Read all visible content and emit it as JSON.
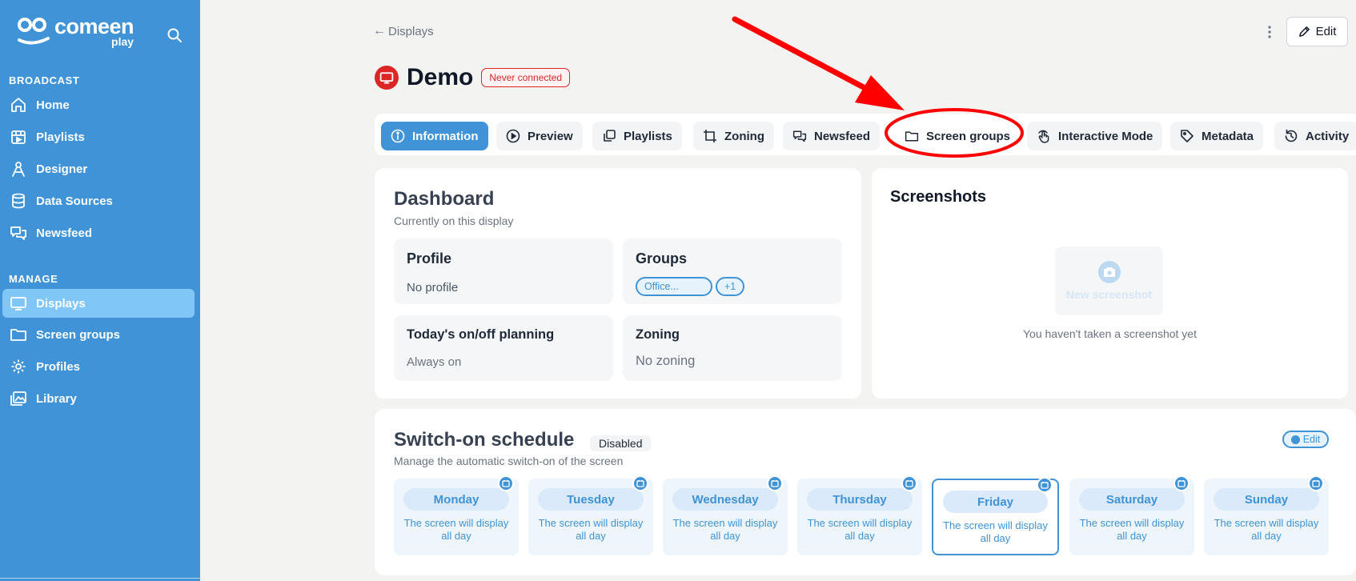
{
  "colors": {
    "sidebar": "#3f93d6",
    "accent": "#3f93d6",
    "active_nav": "#80c6f7",
    "danger": "#dc2626"
  },
  "brand": {
    "name": "comeen",
    "sub": "play"
  },
  "sidebar": {
    "broadcast_label": "BROADCAST",
    "manage_label": "MANAGE",
    "broadcast_items": [
      {
        "label": "Home",
        "icon": "home-icon"
      },
      {
        "label": "Playlists",
        "icon": "playlist-icon"
      },
      {
        "label": "Designer",
        "icon": "designer-icon"
      },
      {
        "label": "Data Sources",
        "icon": "database-icon"
      },
      {
        "label": "Newsfeed",
        "icon": "newsfeed-icon"
      }
    ],
    "manage_items": [
      {
        "label": "Displays",
        "icon": "display-icon",
        "active": true
      },
      {
        "label": "Screen groups",
        "icon": "folder-icon"
      },
      {
        "label": "Profiles",
        "icon": "gear-icon"
      },
      {
        "label": "Library",
        "icon": "library-icon"
      }
    ]
  },
  "header": {
    "back_label": "Displays",
    "title": "Demo",
    "status_badge": "Never connected",
    "edit_label": "Edit"
  },
  "tabs": [
    {
      "label": "Information",
      "icon": "info-icon",
      "active": true
    },
    {
      "label": "Preview",
      "icon": "play-icon"
    },
    {
      "label": "Playlists",
      "icon": "copy-icon"
    },
    {
      "label": "Zoning",
      "icon": "crop-icon"
    },
    {
      "label": "Newsfeed",
      "icon": "newsfeed-icon"
    },
    {
      "label": "Screen groups",
      "icon": "folder-icon"
    },
    {
      "label": "Interactive Mode",
      "icon": "touch-icon"
    },
    {
      "label": "Metadata",
      "icon": "tag-icon"
    },
    {
      "label": "Activity",
      "icon": "history-icon"
    }
  ],
  "dashboard": {
    "title": "Dashboard",
    "subtitle": "Currently on this display",
    "profile": {
      "title": "Profile",
      "value": "No profile"
    },
    "groups": {
      "title": "Groups",
      "tags": [
        "Office...",
        "+1"
      ]
    },
    "planning": {
      "title": "Today's on/off planning",
      "value": "Always on"
    },
    "zoning": {
      "title": "Zoning",
      "value": "No zoning"
    }
  },
  "screenshots": {
    "title": "Screenshots",
    "button_label": "New screenshot",
    "empty_text": "You haven't taken a screenshot yet"
  },
  "schedule": {
    "title": "Switch-on schedule",
    "status": "Disabled",
    "subtitle": "Manage the automatic switch-on of the screen",
    "edit_label": "Edit",
    "days": [
      {
        "name": "Monday",
        "desc": "The screen will display all day"
      },
      {
        "name": "Tuesday",
        "desc": "The screen will display all day"
      },
      {
        "name": "Wednesday",
        "desc": "The screen will display all day"
      },
      {
        "name": "Thursday",
        "desc": "The screen will display all day"
      },
      {
        "name": "Friday",
        "desc": "The screen will display all day",
        "selected": true
      },
      {
        "name": "Saturday",
        "desc": "The screen will display all day"
      },
      {
        "name": "Sunday",
        "desc": "The screen will display all day"
      }
    ]
  }
}
